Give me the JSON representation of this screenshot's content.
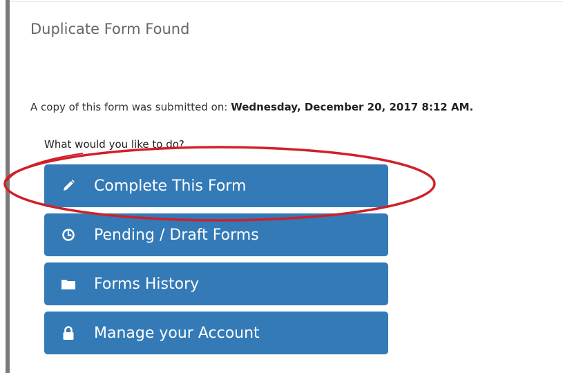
{
  "dialog": {
    "title": "Duplicate Form Found",
    "message_prefix": "A copy of this form was submitted on: ",
    "submitted_date": "Wednesday, December 20, 2017 8:12 AM.",
    "question": "What would you like to do?"
  },
  "actions": [
    {
      "label": "Complete This Form",
      "icon": "pencil-icon"
    },
    {
      "label": "Pending / Draft Forms",
      "icon": "clock-icon"
    },
    {
      "label": "Forms History",
      "icon": "folder-icon"
    },
    {
      "label": "Manage your Account",
      "icon": "lock-icon"
    }
  ],
  "colors": {
    "button_bg": "#337ab7",
    "button_text": "#ffffff",
    "annotation": "#d0202a",
    "sidebar_bar": "#7a7a7a"
  }
}
